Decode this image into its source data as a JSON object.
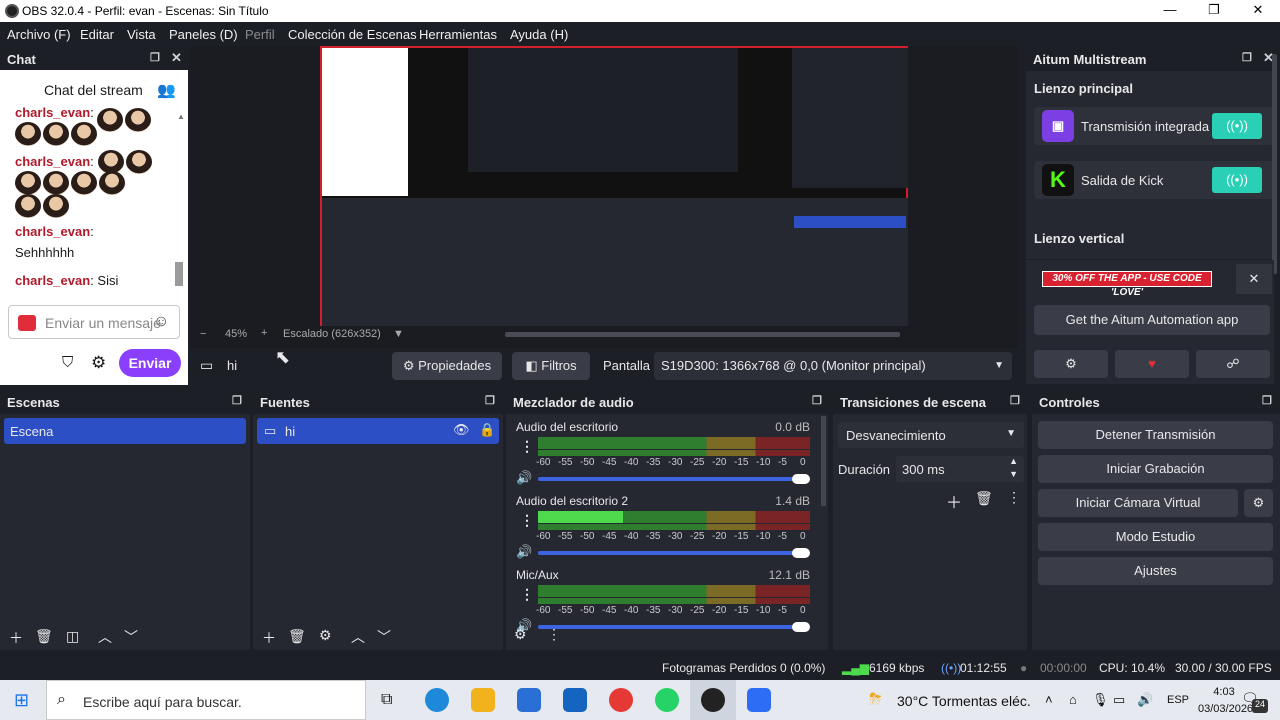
{
  "window": {
    "title": "OBS 32.0.4 - Perfil: evan - Escenas: Sin Título"
  },
  "menu": [
    "Archivo (F)",
    "Editar",
    "Vista",
    "Paneles (D)",
    "Perfil",
    "Colección de Escenas",
    "Herramientas",
    "Ayuda (H)"
  ],
  "chat": {
    "dock_title": "Chat",
    "header": "Chat del stream",
    "messages": [
      {
        "user": "charls_evan",
        "text": ""
      },
      {
        "user": "charls_evan",
        "text": ""
      },
      {
        "user": "charls_evan",
        "text": "Sehhhhhh"
      },
      {
        "user": "charls_evan",
        "text": "Sisi"
      }
    ],
    "input_placeholder": "Enviar un mensaje",
    "send_label": "Enviar"
  },
  "preview": {
    "zoom": "45%",
    "scaling": "Escalado (626x352)"
  },
  "source_bar": {
    "source": "hi",
    "props": "Propiedades",
    "filters": "Filtros",
    "screen_label": "Pantalla",
    "screen_value": "S19D300: 1366x768 @ 0,0 (Monitor principal)"
  },
  "aitum": {
    "title": "Aitum Multistream",
    "main_canvas": "Lienzo principal",
    "outputs": [
      {
        "name": "Transmisión integrada",
        "color": "#7b3fe4"
      },
      {
        "name": "Salida de Kick",
        "color": "#53fc18"
      }
    ],
    "vertical_canvas": "Lienzo vertical",
    "promo": "30% OFF THE APP - USE CODE 'LOVE'",
    "get_app": "Get the Aitum Automation app"
  },
  "scenes": {
    "title": "Escenas",
    "items": [
      "Escena"
    ]
  },
  "sources": {
    "title": "Fuentes",
    "items": [
      "hi"
    ]
  },
  "mixer": {
    "title": "Mezclador de audio",
    "ticks": [
      "-60",
      "-55",
      "-50",
      "-45",
      "-40",
      "-35",
      "-30",
      "-25",
      "-20",
      "-15",
      "-10",
      "-5",
      "0"
    ],
    "channels": [
      {
        "name": "Audio del escritorio",
        "db": "0.0 dB",
        "level": 0.0
      },
      {
        "name": "Audio del escritorio 2",
        "db": "1.4 dB",
        "level": 0.55
      },
      {
        "name": "Mic/Aux",
        "db": "12.1 dB",
        "level": 0.0
      }
    ]
  },
  "transitions": {
    "title": "Transiciones de escena",
    "type": "Desvanecimiento",
    "duration_label": "Duración",
    "duration": "300 ms"
  },
  "controls": {
    "title": "Controles",
    "buttons": [
      "Detener Transmisión",
      "Iniciar Grabación",
      "Iniciar Cámara Virtual",
      "Modo Estudio",
      "Ajustes"
    ]
  },
  "status": {
    "dropped": "Fotogramas Perdidos 0 (0.0%)",
    "kbps": "6169 kbps",
    "live": "01:12:55",
    "rec": "00:00:00",
    "cpu": "CPU: 10.4%",
    "fps": "30.00 / 30.00 FPS"
  },
  "taskbar": {
    "search": "Escribe aquí para buscar.",
    "weather": "30°C  Tormentas eléc.",
    "lang": "ESP",
    "time": "4:03",
    "date": "03/03/2026",
    "notif": "24"
  }
}
